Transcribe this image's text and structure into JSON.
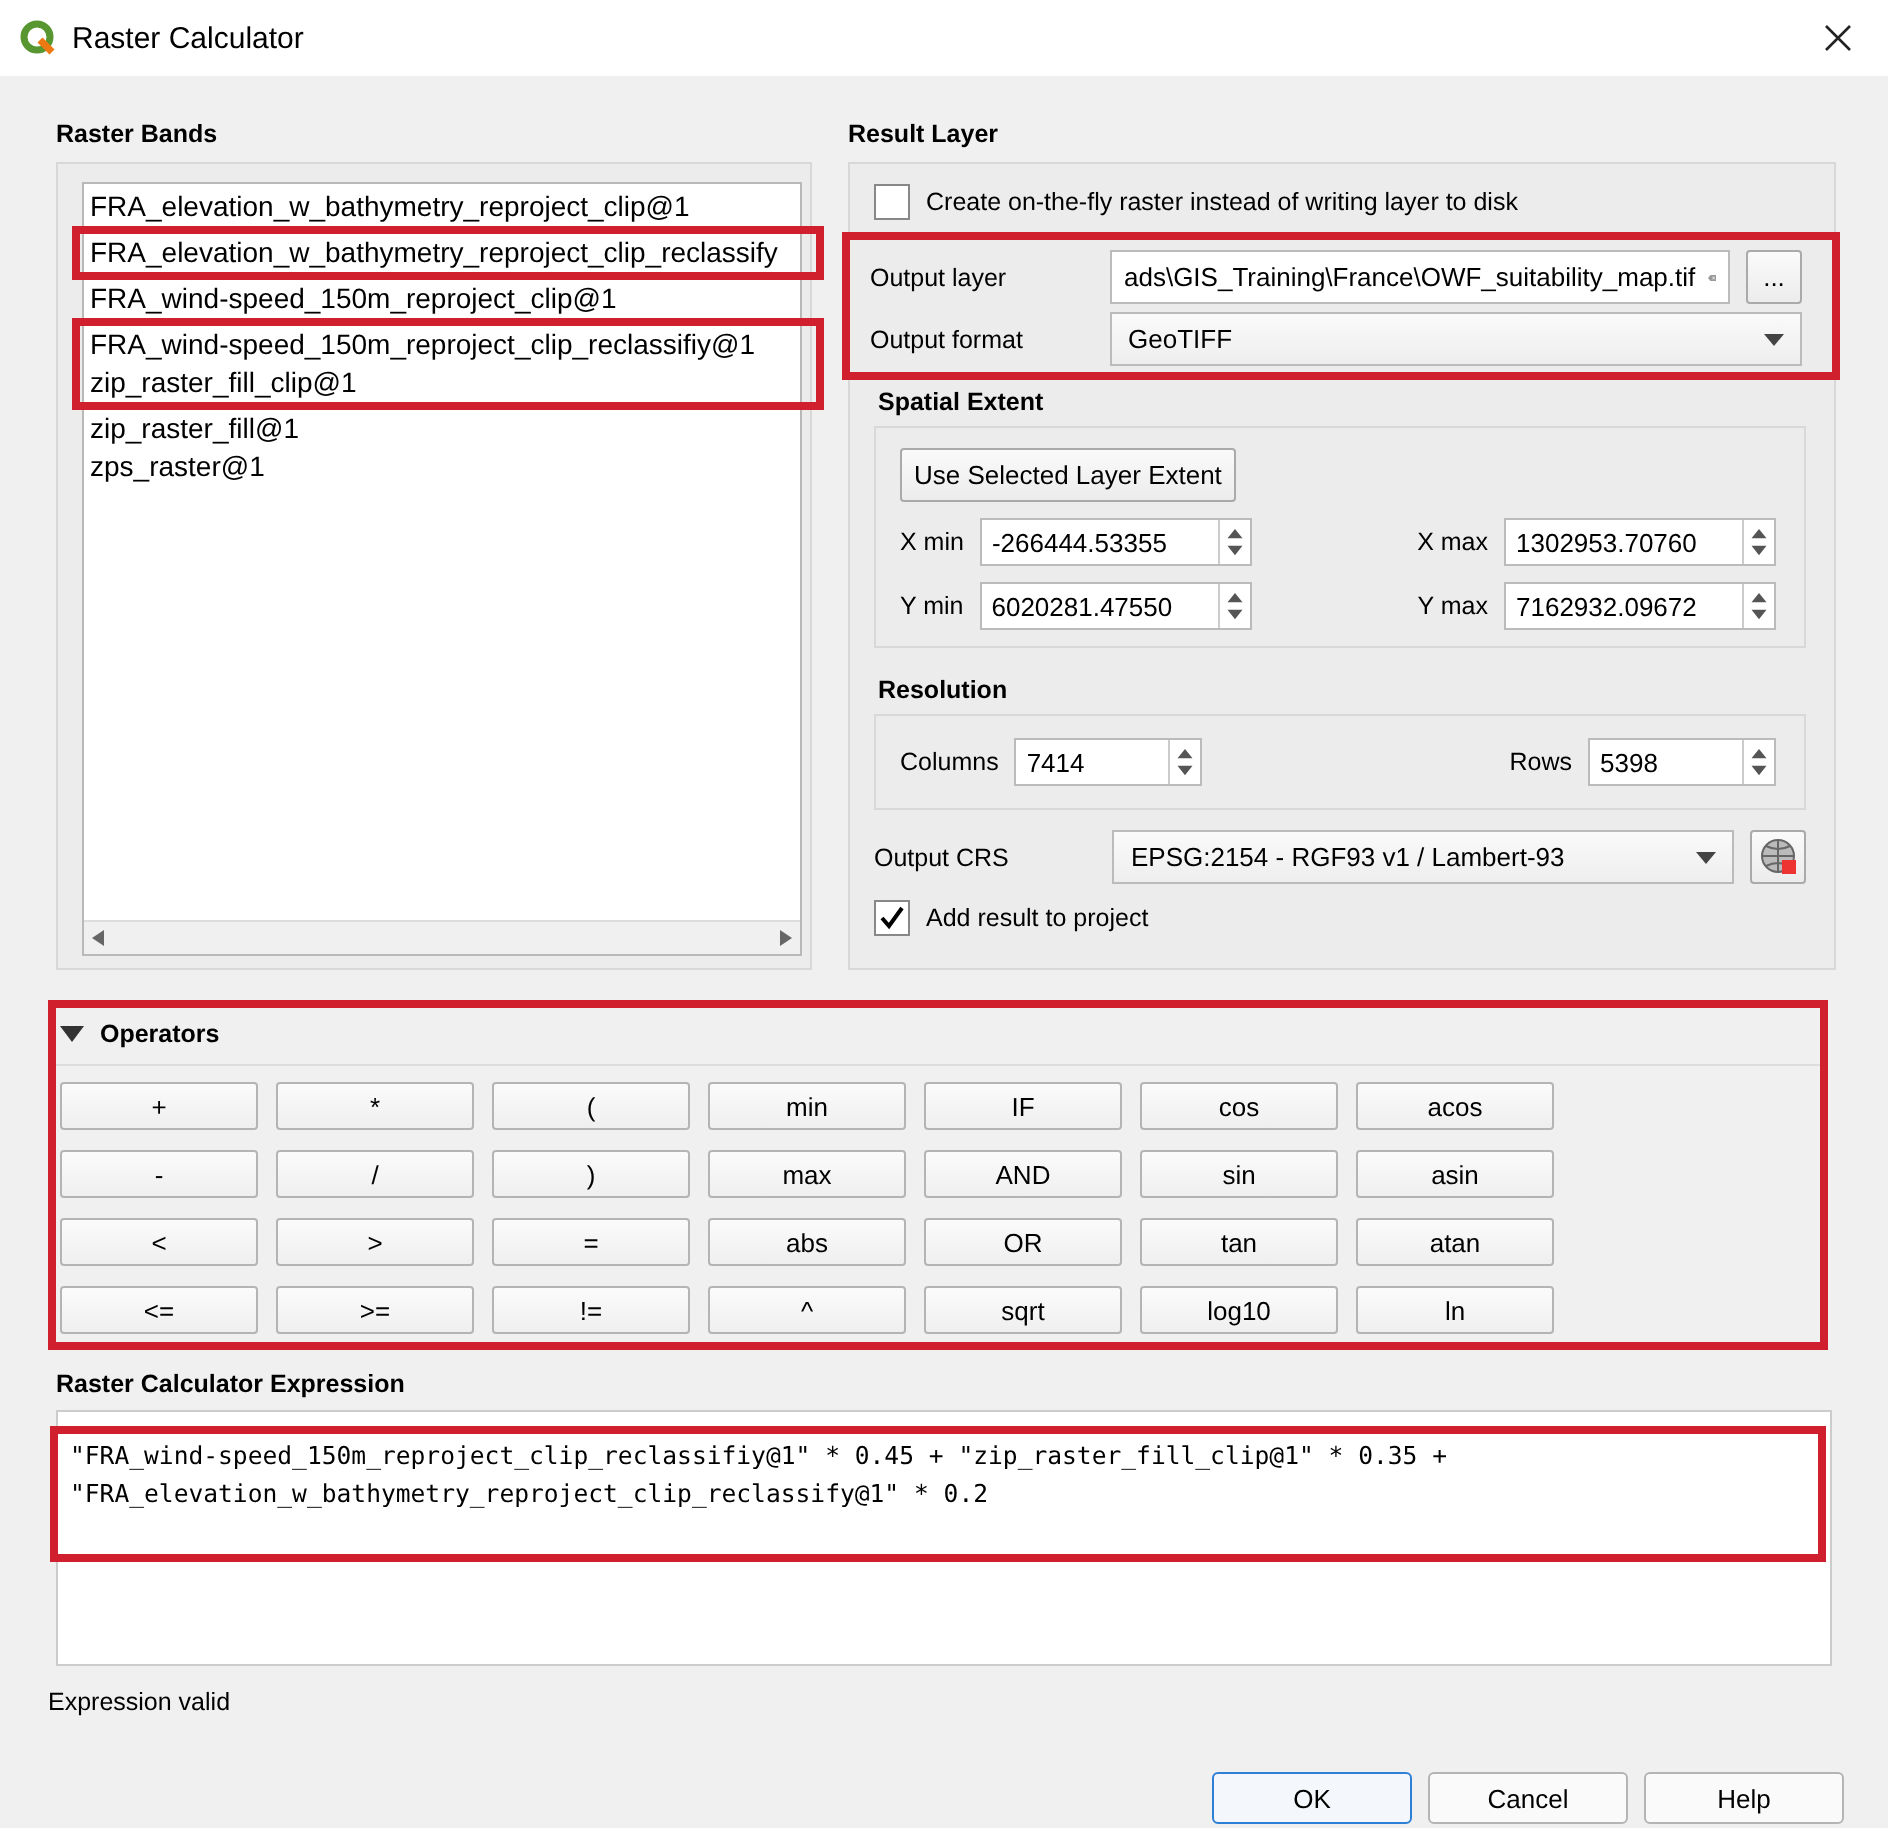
{
  "window": {
    "title": "Raster Calculator"
  },
  "raster_bands": {
    "title": "Raster Bands",
    "groups": [
      {
        "highlighted": false,
        "items": [
          "FRA_elevation_w_bathymetry_reproject_clip@1"
        ]
      },
      {
        "highlighted": true,
        "items": [
          "FRA_elevation_w_bathymetry_reproject_clip_reclassify"
        ]
      },
      {
        "highlighted": false,
        "items": [
          "FRA_wind-speed_150m_reproject_clip@1"
        ]
      },
      {
        "highlighted": true,
        "items": [
          "FRA_wind-speed_150m_reproject_clip_reclassifiy@1",
          "zip_raster_fill_clip@1"
        ]
      },
      {
        "highlighted": false,
        "items": [
          "zip_raster_fill@1",
          "zps_raster@1"
        ]
      }
    ]
  },
  "result_layer": {
    "title": "Result Layer",
    "on_the_fly": {
      "label": "Create on-the-fly raster instead of writing layer to disk",
      "checked": false
    },
    "output": {
      "highlighted": true,
      "layer_label": "Output layer",
      "layer_value": "ads\\GIS_Training\\France\\OWF_suitability_map.tif",
      "browse": "...",
      "format_label": "Output format",
      "format_value": "GeoTIFF"
    },
    "spatial_extent": {
      "title": "Spatial Extent",
      "button": "Use Selected Layer Extent",
      "fields": [
        {
          "label": "X min",
          "value": "-266444.53355"
        },
        {
          "label": "X max",
          "value": "1302953.70760"
        },
        {
          "label": "Y min",
          "value": "6020281.47550"
        },
        {
          "label": "Y max",
          "value": "7162932.09672"
        }
      ]
    },
    "resolution": {
      "title": "Resolution",
      "fields": [
        {
          "label": "Columns",
          "value": "7414"
        },
        {
          "label": "Rows",
          "value": "5398"
        }
      ]
    },
    "output_crs": {
      "label": "Output CRS",
      "value": "EPSG:2154 - RGF93 v1 / Lambert-93"
    },
    "add_result": {
      "label": "Add result to project",
      "checked": true
    }
  },
  "operators": {
    "title": "Operators",
    "expanded": true,
    "highlighted": true,
    "buttons": [
      "+",
      "*",
      "(",
      "min",
      "IF",
      "cos",
      "acos",
      "-",
      "/",
      ")",
      "max",
      "AND",
      "sin",
      "asin",
      "<",
      ">",
      "=",
      "abs",
      "OR",
      "tan",
      "atan",
      "<=",
      ">=",
      "!=",
      "^",
      "sqrt",
      "log10",
      "ln"
    ]
  },
  "expression": {
    "title": "Raster Calculator Expression",
    "highlighted": true,
    "lines": [
      "\"FRA_wind-speed_150m_reproject_clip_reclassifiy@1\" * 0.45 + \"zip_raster_fill_clip@1\" * 0.35 +",
      "\"FRA_elevation_w_bathymetry_reproject_clip_reclassify@1\" * 0.2"
    ]
  },
  "status": "Expression valid",
  "buttons": [
    {
      "label": "OK",
      "default": true
    },
    {
      "label": "Cancel",
      "default": false
    },
    {
      "label": "Help",
      "default": false
    }
  ]
}
